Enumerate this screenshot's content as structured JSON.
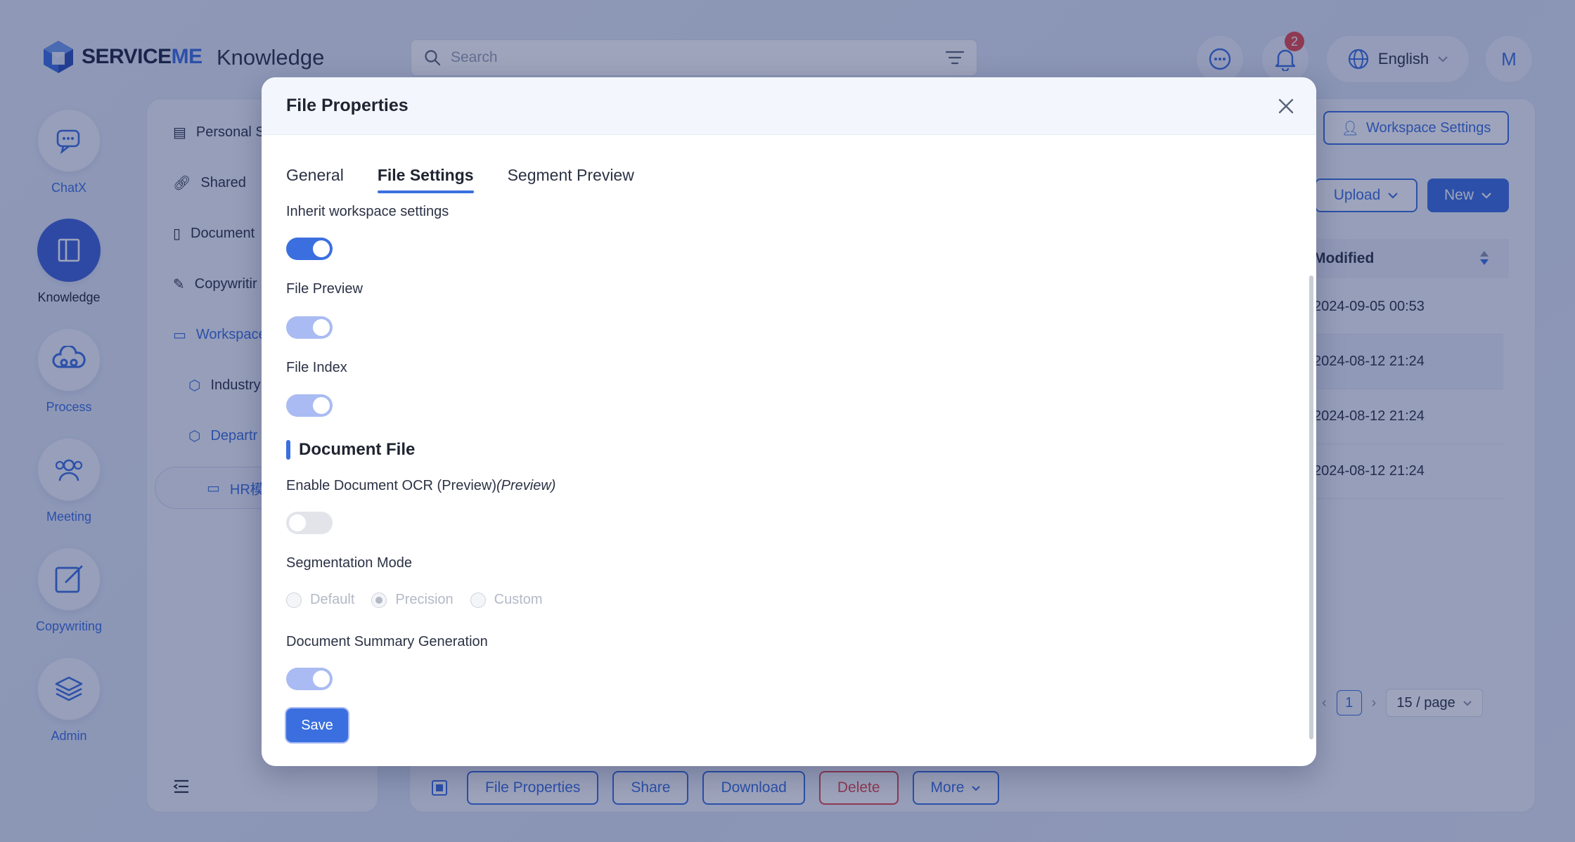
{
  "header": {
    "logo_text_service": "SERVICE",
    "logo_text_me": "ME",
    "app_title": "Knowledge",
    "search_placeholder": "Search",
    "notification_count": "2",
    "language": "English",
    "avatar_initial": "M"
  },
  "rail": {
    "items": [
      {
        "label": "ChatX",
        "icon": "chat-icon"
      },
      {
        "label": "Knowledge",
        "icon": "book-icon"
      },
      {
        "label": "Process",
        "icon": "cloud-flow-icon"
      },
      {
        "label": "Meeting",
        "icon": "people-icon"
      },
      {
        "label": "Copywriting",
        "icon": "edit-icon"
      },
      {
        "label": "Admin",
        "icon": "layers-icon"
      }
    ]
  },
  "left_panel": {
    "items": [
      {
        "label": "Personal S"
      },
      {
        "label": "Shared"
      },
      {
        "label": "Document"
      },
      {
        "label": "Copywritir"
      },
      {
        "label": "Workspace"
      },
      {
        "label": "Industry"
      },
      {
        "label": "Departr"
      },
      {
        "label": "HR模"
      }
    ]
  },
  "main": {
    "workspace_settings": "Workspace Settings",
    "upload": "Upload",
    "new": "New",
    "column_modified": "Modified",
    "rows": [
      "2024-09-05 00:53",
      "2024-08-12 21:24",
      "2024-08-12 21:24",
      "2024-08-12 21:24"
    ],
    "page_current": "1",
    "page_size": "15 / page",
    "actions": {
      "file_properties": "File Properties",
      "share": "Share",
      "download": "Download",
      "delete": "Delete",
      "more": "More"
    }
  },
  "modal": {
    "title": "File Properties",
    "tabs": [
      "General",
      "File Settings",
      "Segment Preview"
    ],
    "active_tab": "File Settings",
    "inherit_label": "Inherit workspace settings",
    "inherit_on": true,
    "file_preview_label": "File Preview",
    "file_preview_on": true,
    "file_index_label": "File Index",
    "file_index_on": true,
    "section_document": "Document File",
    "ocr_label": "Enable Document OCR (Preview)",
    "ocr_suffix": "(Preview)",
    "ocr_on": false,
    "segmentation_label": "Segmentation Mode",
    "segmentation_options": [
      "Default",
      "Precision",
      "Custom"
    ],
    "segmentation_selected": "Precision",
    "summary_label": "Document Summary Generation",
    "summary_on": true,
    "save": "Save"
  },
  "colors": {
    "accent": "#3b6fe0",
    "danger": "#e5484d"
  }
}
